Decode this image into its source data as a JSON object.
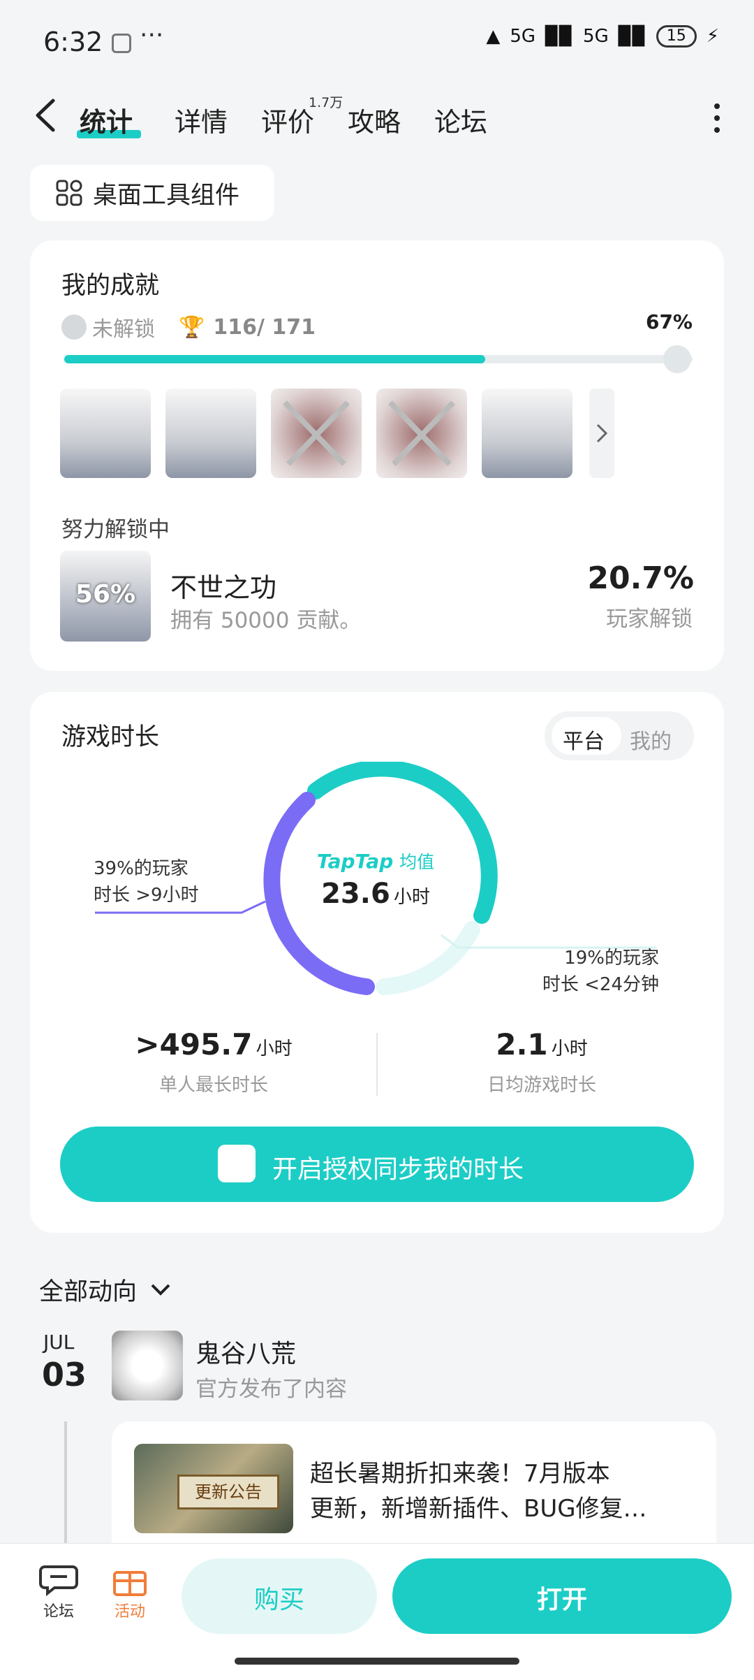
{
  "status_bar": {
    "time": "6:32",
    "dots": "···",
    "net1": "5G",
    "net2": "5G",
    "battery": "15"
  },
  "nav": {
    "tabs": [
      {
        "label": "统计"
      },
      {
        "label": "详情"
      },
      {
        "label": "评价"
      },
      {
        "label": "攻略"
      },
      {
        "label": "论坛"
      }
    ],
    "review_count": "1.7万"
  },
  "widget_chip": {
    "label": "桌面工具组件"
  },
  "achievements": {
    "title": "我的成就",
    "locked_label": "未解锁",
    "progress_text": "116/ 171",
    "percent_text": "67%",
    "progress_fraction": 0.67,
    "in_progress_title": "努力解锁中",
    "item": {
      "thumb_percent": "56%",
      "name": "不世之功",
      "desc": "拥有 50000 贡献。",
      "rate": "20.7%",
      "rate_label": "玩家解锁"
    }
  },
  "playtime": {
    "title": "游戏时长",
    "toggle_platform": "平台",
    "toggle_mine": "我的",
    "left_note_1": "39%的玩家",
    "left_note_2": "时长 >9小时",
    "right_note_1": "19%的玩家",
    "right_note_2": "时长 <24分钟",
    "center_brand": "TapTap",
    "center_brand_suffix": "均值",
    "center_value": "23.6",
    "center_unit": "小时",
    "stat1_prefix": ">",
    "stat1_value": "495.7",
    "stat1_unit": "小时",
    "stat1_label": "单人最长时长",
    "stat2_value": "2.1",
    "stat2_unit": "小时",
    "stat2_label": "日均游戏时长",
    "sync_button": "开启授权同步我的时长"
  },
  "feed": {
    "filter_label": "全部动向",
    "month": "JUL",
    "day": "03",
    "author": "鬼谷八荒",
    "action": "官方发布了内容",
    "post_line1": "超长暑期折扣来袭！7月版本",
    "post_line2": "更新，新增新插件、BUG修复…",
    "thumb_text": "更新公告"
  },
  "bottom_bar": {
    "forum_label": "论坛",
    "event_label": "活动",
    "buy_label": "购买",
    "open_label": "打开"
  },
  "colors": {
    "accent": "#1ccdc6",
    "purple": "#7b6cf6",
    "orange": "#f07d3a"
  }
}
